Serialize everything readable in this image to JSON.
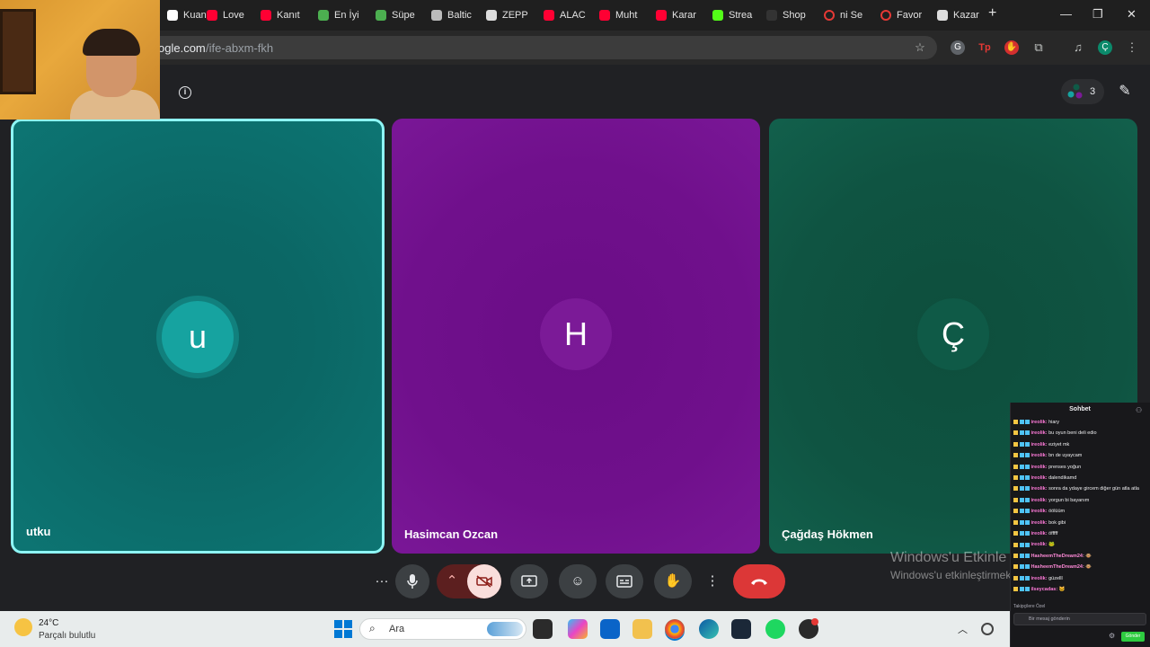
{
  "browser": {
    "tabs": [
      {
        "label": "Kuan",
        "icon": "page-icon",
        "color": "#ffffff"
      },
      {
        "label": "Love",
        "icon": "youtube-icon",
        "color": "#ff0033"
      },
      {
        "label": "Kanıt",
        "icon": "youtube-icon",
        "color": "#ff0033"
      },
      {
        "label": "En İyi",
        "icon": "page-icon",
        "color": "#4caf50"
      },
      {
        "label": "Süpe",
        "icon": "page-icon",
        "color": "#4caf50"
      },
      {
        "label": "Baltic",
        "icon": "page-icon",
        "color": "#bbbbbb"
      },
      {
        "label": "ZEPP",
        "icon": "page-icon",
        "color": "#dddddd"
      },
      {
        "label": "ALAC",
        "icon": "youtube-icon",
        "color": "#ff0033"
      },
      {
        "label": "Muht",
        "icon": "youtube-icon",
        "color": "#ff0033"
      },
      {
        "label": "Karar",
        "icon": "youtube-icon",
        "color": "#ff0033"
      },
      {
        "label": "Strea",
        "icon": "kick-icon",
        "color": "#53fc18"
      },
      {
        "label": "Shop",
        "icon": "page-icon",
        "color": "#333333"
      },
      {
        "label": "ni Se",
        "icon": "circle-icon",
        "color": "#e53935"
      },
      {
        "label": "Favor",
        "icon": "circle-icon",
        "color": "#e53935"
      },
      {
        "label": "Kazar",
        "icon": "doc-icon",
        "color": "#dddddd"
      }
    ],
    "new_tab": "+",
    "url_host": "ogle.com",
    "url_path": "/ife-abxm-fkh",
    "window_controls": {
      "minimize": "—",
      "restore": "❐",
      "close": "✕"
    }
  },
  "meet": {
    "people_count": "3",
    "participants": [
      {
        "name": "utku",
        "initial": "u",
        "color": "#16a3a0"
      },
      {
        "name": "Hasimcan Ozcan",
        "initial": "H",
        "color": "#7b1a97"
      },
      {
        "name": "Çağdaş Hökmen",
        "initial": "Ç",
        "color": "#0f5a47"
      }
    ],
    "controls": {
      "more_left": "···",
      "mic": "mic-icon",
      "camera": "camera-off-icon",
      "present": "present-icon",
      "emoji": "emoji-icon",
      "captions": "captions-icon",
      "hand": "raise-hand-icon",
      "more": "more-vert-icon",
      "leave": "end-call-icon"
    }
  },
  "watermark": {
    "line1": "Windows'u Etkinle",
    "line2": "Windows'u etkinleştirmek"
  },
  "chat": {
    "title": "Sohbet",
    "messages": [
      {
        "user": "ireolik:",
        "text": "hiary"
      },
      {
        "user": "ireolik:",
        "text": "bu oyun beni deli edio"
      },
      {
        "user": "ireolik:",
        "text": "eziyet mk"
      },
      {
        "user": "ireolik:",
        "text": "bn de uyaycam"
      },
      {
        "user": "ireolik:",
        "text": "prenses yoğun"
      },
      {
        "user": "ireolik:",
        "text": "dalendikamd"
      },
      {
        "user": "ireolik:",
        "text": "sonra da ydaye gircem diğer gün atla atla"
      },
      {
        "user": "ireolik:",
        "text": "yorgun bi bayanım"
      },
      {
        "user": "ireolik:",
        "text": "öölüüm"
      },
      {
        "user": "ireolik:",
        "text": "bok gibi"
      },
      {
        "user": "ireolik:",
        "text": "öfffff"
      },
      {
        "user": "ireolik:",
        "text": "🐸"
      },
      {
        "user": "HasheemTheDream24:",
        "text": "🐵"
      },
      {
        "user": "HasheemTheDream24:",
        "text": "🐵"
      },
      {
        "user": "ireolik:",
        "text": "güzelll"
      },
      {
        "user": "ilseycadas:",
        "text": "🐱"
      }
    ],
    "pinned": "Takipçilere Özel",
    "input_placeholder": "Bir mesaj gönderin",
    "send_label": "Gönder"
  },
  "taskbar": {
    "temp": "24°C",
    "condition": "Parçalı bulutlu",
    "search_label": "Ara"
  }
}
